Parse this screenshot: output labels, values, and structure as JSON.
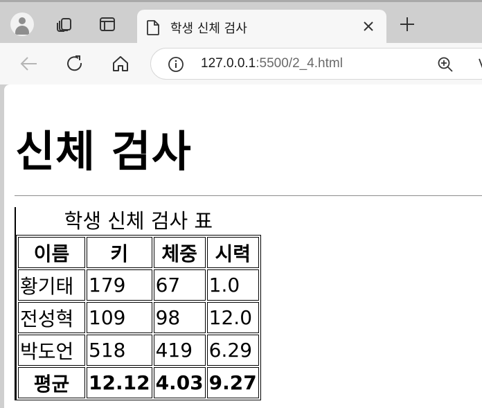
{
  "browser": {
    "tab_title": "학생 신체 검사",
    "url_host": "127.0.0.1",
    "url_rest": ":5500/2_4.html"
  },
  "page": {
    "heading": "신체 검사",
    "table": {
      "caption": "학생 신체 검사 표",
      "headers": [
        "이름",
        "키",
        "체중",
        "시력"
      ],
      "rows": [
        [
          "황기태",
          "179",
          "67",
          "1.0"
        ],
        [
          "전성혁",
          "109",
          "98",
          "12.0"
        ],
        [
          "박도언",
          "518",
          "419",
          "6.29"
        ]
      ],
      "average": [
        "평균",
        "12.12",
        "4.03",
        "9.27"
      ]
    }
  }
}
